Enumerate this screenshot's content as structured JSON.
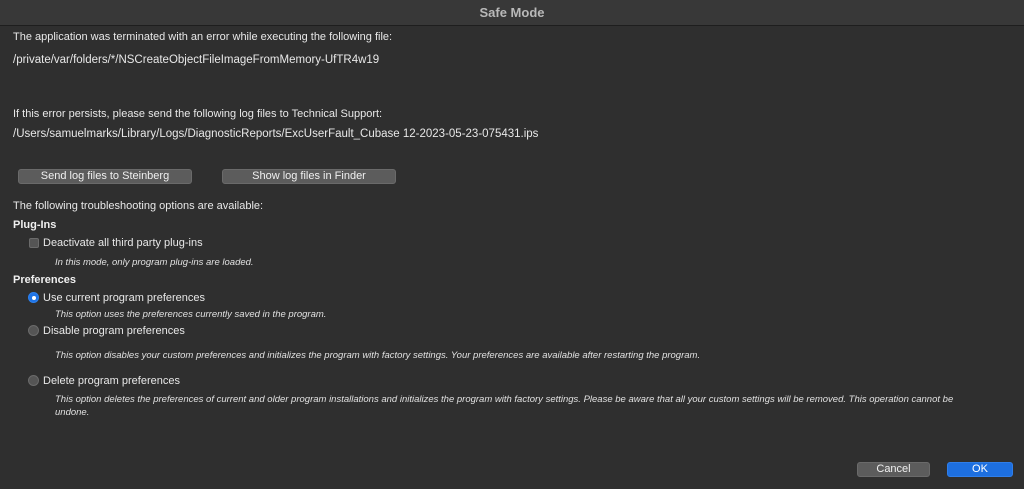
{
  "window": {
    "title": "Safe Mode"
  },
  "error": {
    "intro": "The application was terminated with an error while executing the following file:",
    "file_path": "/private/var/folders/*/NSCreateObjectFileImageFromMemory-UfTR4w19",
    "persist_text": "If this error persists, please send the following log files to Technical Support:",
    "log_path": "/Users/samuelmarks/Library/Logs/DiagnosticReports/ExcUserFault_Cubase 12-2023-05-23-075431.ips"
  },
  "actions": {
    "send_logs_label": "Send log files to Steinberg",
    "show_logs_label": "Show log files in Finder"
  },
  "troubleshooting": {
    "intro": "The following troubleshooting options are available:",
    "plugins": {
      "heading": "Plug-Ins",
      "deactivate_label": "Deactivate all third party plug-ins",
      "deactivate_checked": false,
      "deactivate_hint": "In this mode, only program plug-ins are loaded."
    },
    "preferences": {
      "heading": "Preferences",
      "selected": "use_current",
      "use_current_label": "Use current program preferences",
      "use_current_hint": "This option uses the preferences currently saved in the program.",
      "disable_label": "Disable program preferences",
      "disable_hint": "This option disables your custom preferences and initializes the program with factory settings. Your preferences are available after restarting the program.",
      "delete_label": "Delete program preferences",
      "delete_hint": "This option deletes the preferences of current and older program installations and initializes the program with factory settings. Please be aware that all your custom settings will be removed. This operation cannot be undone."
    }
  },
  "footer": {
    "cancel_label": "Cancel",
    "ok_label": "OK"
  },
  "colors": {
    "background": "#2f2f2f",
    "accent": "#1d6fe0"
  }
}
